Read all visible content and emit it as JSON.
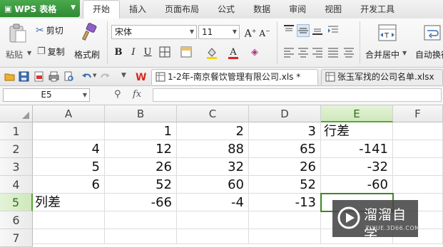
{
  "app": {
    "name": "WPS 表格",
    "brand_color": "#3a9a3e"
  },
  "menu": {
    "items": [
      "开始",
      "插入",
      "页面布局",
      "公式",
      "数据",
      "审阅",
      "视图",
      "开发工具"
    ],
    "active": "开始"
  },
  "ribbon": {
    "paste_label": "粘贴",
    "cut_label": "剪切",
    "copy_label": "复制",
    "format_painter_label": "格式刷",
    "font_name": "宋体",
    "font_size": "11",
    "bold_glyph": "B",
    "italic_glyph": "I",
    "underline_glyph": "U",
    "merge_center_label": "合并居中",
    "auto_wrap_label": "自动换行"
  },
  "doc_tabs": [
    {
      "title": "1-2年-南京餐饮管理有限公司.xls *",
      "active": true
    },
    {
      "title": "张玉军找的公司名单.xlsx",
      "active": false
    }
  ],
  "formula_bar": {
    "name_box": "E5",
    "fx_label": "fx",
    "formula": ""
  },
  "sheet": {
    "columns": [
      "A",
      "B",
      "C",
      "D",
      "E",
      "F"
    ],
    "rows": [
      "1",
      "2",
      "3",
      "4",
      "5",
      "6",
      "7"
    ],
    "selected_column": "E",
    "selected_row": "5",
    "cells": {
      "r1": {
        "A": "",
        "B": "1",
        "C": "2",
        "D": "3",
        "E": "行差"
      },
      "r2": {
        "A": "4",
        "B": "12",
        "C": "88",
        "D": "65",
        "E": "-141"
      },
      "r3": {
        "A": "5",
        "B": "26",
        "C": "32",
        "D": "26",
        "E": "-32"
      },
      "r4": {
        "A": "6",
        "B": "52",
        "C": "60",
        "D": "52",
        "E": "-60"
      },
      "r5": {
        "A": "列差",
        "B": "-66",
        "C": "-4",
        "D": "-13",
        "E": ""
      }
    },
    "selection_color": "#3c8a24"
  },
  "watermark": {
    "title": "溜溜自学",
    "subtitle": "ZIXUE.3D66.COM"
  }
}
